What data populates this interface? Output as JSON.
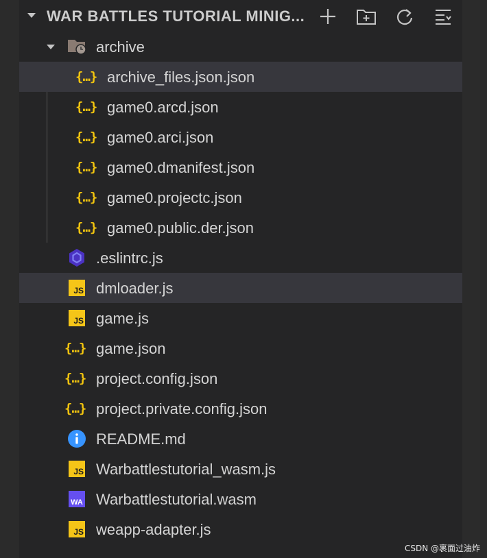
{
  "header": {
    "title": "WAR BATTLES TUTORIAL MINIG...",
    "new_file_icon": "plus-icon",
    "new_folder_icon": "new-folder-icon",
    "refresh_icon": "refresh-icon",
    "collapse_icon": "collapse-all-icon"
  },
  "folder": {
    "name": "archive",
    "icon": "folder-history-icon"
  },
  "archive_files": [
    {
      "name": "archive_files.json.json",
      "icon": "json-icon"
    },
    {
      "name": "game0.arcd.json",
      "icon": "json-icon"
    },
    {
      "name": "game0.arci.json",
      "icon": "json-icon"
    },
    {
      "name": "game0.dmanifest.json",
      "icon": "json-icon"
    },
    {
      "name": "game0.projectc.json",
      "icon": "json-icon"
    },
    {
      "name": "game0.public.der.json",
      "icon": "json-icon"
    }
  ],
  "files": [
    {
      "name": ".eslintrc.js",
      "icon": "eslint-icon"
    },
    {
      "name": "dmloader.js",
      "icon": "js-icon"
    },
    {
      "name": "game.js",
      "icon": "js-icon"
    },
    {
      "name": "game.json",
      "icon": "json-icon"
    },
    {
      "name": "project.config.json",
      "icon": "json-icon"
    },
    {
      "name": "project.private.config.json",
      "icon": "json-icon"
    },
    {
      "name": "README.md",
      "icon": "info-icon"
    },
    {
      "name": "Warbattlestutorial_wasm.js",
      "icon": "js-icon"
    },
    {
      "name": "Warbattlestutorial.wasm",
      "icon": "wasm-icon"
    },
    {
      "name": "weapp-adapter.js",
      "icon": "js-icon"
    }
  ],
  "icon_text": {
    "json": "{…}",
    "js": "JS",
    "wasm": "WA"
  },
  "watermark": "CSDN @裹面过油炸",
  "colors": {
    "background": "#252526",
    "selected_row": "#37373d",
    "json": "#f1c40f",
    "js": "#f5c518",
    "wasm": "#654ff0",
    "eslint": "#4b32c3",
    "info": "#3794ff"
  }
}
